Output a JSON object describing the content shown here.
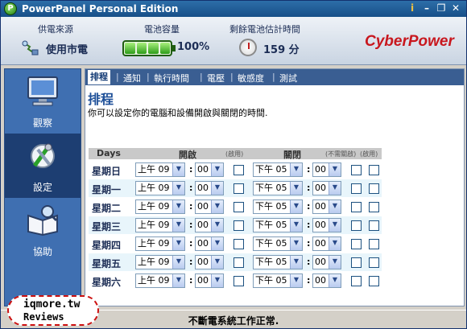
{
  "window": {
    "title": "PowerPanel Personal Edition",
    "logo_letter": "P",
    "info_glyph": "i",
    "min_glyph": "–",
    "restore_glyph": "❐",
    "close_glyph": "✕"
  },
  "header": {
    "power_source_label": "供電來源",
    "power_source_value": "使用市電",
    "battery_label": "電池容量",
    "battery_value": "100%",
    "runtime_label": "剩餘電池估計時間",
    "runtime_value": "159 分",
    "brand": "CyberPower"
  },
  "sidebar": {
    "items": [
      {
        "label": "觀察",
        "icon": "monitor-icon"
      },
      {
        "label": "設定",
        "icon": "tools-icon"
      },
      {
        "label": "協助",
        "icon": "help-book-icon"
      }
    ]
  },
  "tabs": [
    {
      "label": "排程"
    },
    {
      "label": "通知"
    },
    {
      "label": "執行時間"
    },
    {
      "label": "電壓"
    },
    {
      "label": "敏感度"
    },
    {
      "label": "測試"
    }
  ],
  "page": {
    "title": "排程",
    "description": "你可以設定你的電腦和設備開啟與關閉的時間."
  },
  "schedule": {
    "col_days": "Days",
    "col_on": "開啟",
    "col_on_enable": "(啟用)",
    "col_off": "關閉",
    "col_off_no_shutdown": "(不需關啟)",
    "col_off_enable": "(啟用)",
    "rows": [
      {
        "day": "星期日",
        "on_hour": "上午 09",
        "on_min": "00",
        "off_hour": "下午 05",
        "off_min": "00"
      },
      {
        "day": "星期一",
        "on_hour": "上午 09",
        "on_min": "00",
        "off_hour": "下午 05",
        "off_min": "00"
      },
      {
        "day": "星期二",
        "on_hour": "上午 09",
        "on_min": "00",
        "off_hour": "下午 05",
        "off_min": "00"
      },
      {
        "day": "星期三",
        "on_hour": "上午 09",
        "on_min": "00",
        "off_hour": "下午 05",
        "off_min": "00"
      },
      {
        "day": "星期四",
        "on_hour": "上午 09",
        "on_min": "00",
        "off_hour": "下午 05",
        "off_min": "00"
      },
      {
        "day": "星期五",
        "on_hour": "上午 09",
        "on_min": "00",
        "off_hour": "下午 05",
        "off_min": "00"
      },
      {
        "day": "星期六",
        "on_hour": "上午 09",
        "on_min": "00",
        "off_hour": "下午 05",
        "off_min": "00"
      }
    ]
  },
  "status": {
    "text": "不斷電系統工作正常."
  },
  "watermark": {
    "line1": "iqmore.tw",
    "line2": "Reviews"
  }
}
